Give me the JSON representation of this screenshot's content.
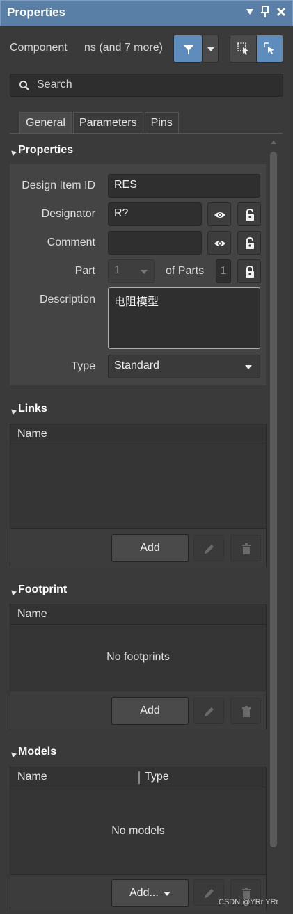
{
  "titlebar": {
    "title": "Properties"
  },
  "filter": {
    "label_left": "Component",
    "label_right": "ns (and 7 more)"
  },
  "search": {
    "placeholder": "Search"
  },
  "tabs": [
    "General",
    "Parameters",
    "Pins"
  ],
  "sections": {
    "properties": "Properties",
    "links": "Links",
    "footprint": "Footprint",
    "models": "Models"
  },
  "properties": {
    "design_item_id_label": "Design Item ID",
    "design_item_id": "RES",
    "designator_label": "Designator",
    "designator": "R?",
    "comment_label": "Comment",
    "comment": "",
    "part_label": "Part",
    "part_value": "1",
    "of_parts_label": "of Parts",
    "of_parts_value": "1",
    "description_label": "Description",
    "description": "电阻模型",
    "type_label": "Type",
    "type": "Standard"
  },
  "links": {
    "col_name": "Name",
    "add_label": "Add"
  },
  "footprint": {
    "col_name": "Name",
    "empty": "No footprints",
    "add_label": "Add"
  },
  "models": {
    "col_name": "Name",
    "col_type": "Type",
    "empty": "No models",
    "add_label": "Add..."
  },
  "watermark": "CSDN @YRr YRr",
  "colors": {
    "accent": "#5d8cbd",
    "titlebar": "#5a7fa6",
    "panel": "#3a3a3a"
  }
}
